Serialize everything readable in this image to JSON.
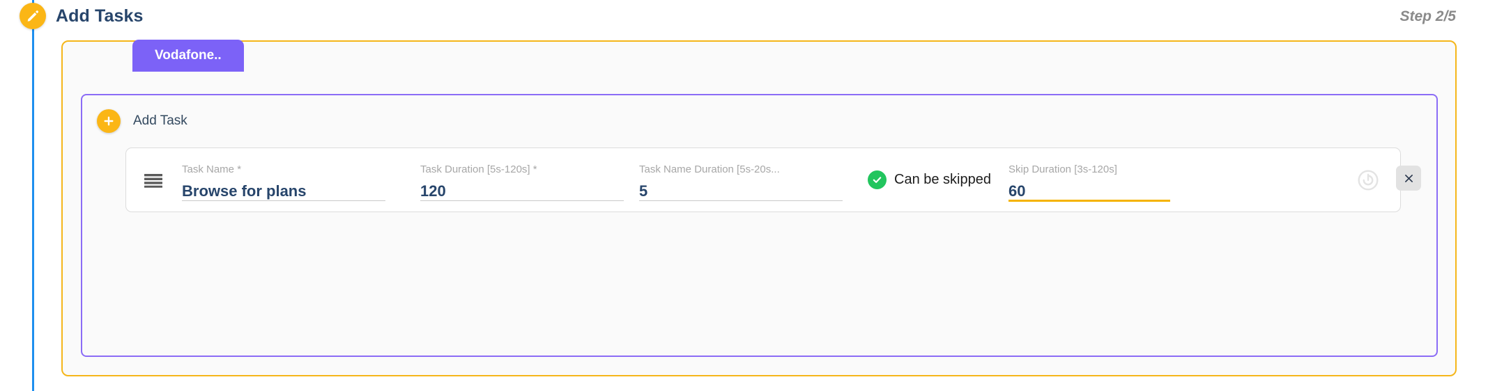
{
  "header": {
    "title": "Add Tasks",
    "step_indicator": "Step 2/5",
    "marker_icon": "pencil-icon"
  },
  "tabs": [
    {
      "label": "Vodafone..",
      "active": true
    }
  ],
  "panel": {
    "add_task": {
      "label": "Add Task",
      "icon": "plus-icon"
    }
  },
  "task_row": {
    "drag_handle_icon": "drag-handle-icon",
    "fields": [
      {
        "name": "task-name",
        "label": "Task Name *",
        "value": "Browse for plans",
        "active": false
      },
      {
        "name": "task-duration",
        "label": "Task Duration [5s-120s] *",
        "value": "120",
        "active": false
      },
      {
        "name": "task-name-duration",
        "label": "Task Name Duration [5s-20s...",
        "value": "5",
        "active": false
      },
      {
        "name": "skip-duration",
        "label": "Skip Duration [3s-120s]",
        "value": "60",
        "active": true
      }
    ],
    "skip_toggle": {
      "label": "Can be skipped",
      "checked": true,
      "icon": "check-circle-icon"
    },
    "power_icon": "power-icon",
    "remove_icon": "close-icon"
  },
  "colors": {
    "accent_amber": "#F5B61A",
    "accent_purple": "#7C62F7",
    "title_navy": "#27456B",
    "timeline_blue": "#1E8FEF",
    "success_green": "#22C55E",
    "label_gray": "#A7A7A7"
  }
}
